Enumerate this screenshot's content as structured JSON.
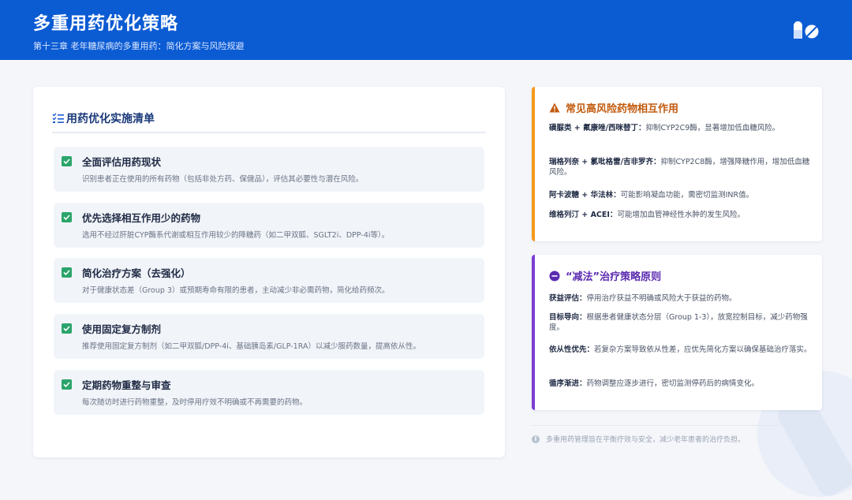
{
  "header": {
    "title": "多重用药优化策略",
    "subtitle": "第十三章 老年糖尿病的多重用药：简化方案与风险规避",
    "logo_icon": "pills-icon"
  },
  "colors": {
    "header_bg": "#0b5bd3",
    "check": "#2ba56b",
    "warning_accent": "#f39a1a",
    "strategy_accent": "#7a3ed1"
  },
  "checklist": {
    "title": "用药优化实施清单",
    "icon": "checklist-icon",
    "items": [
      {
        "title": "全面评估用药现状",
        "desc": "识别患者正在使用的所有药物（包括非处方药、保健品），评估其必要性与潜在风险。"
      },
      {
        "title": "优先选择相互作用少的药物",
        "desc": "选用不经过肝脏CYP酶系代谢或相互作用较少的降糖药（如二甲双胍、SGLT2i、DPP-4i等）。"
      },
      {
        "title": "简化治疗方案（去强化）",
        "desc": "对于健康状态差（Group 3）或预期寿命有限的患者，主动减少非必需药物，简化给药频次。"
      },
      {
        "title": "使用固定复方制剂",
        "desc": "推荐使用固定复方制剂（如二甲双胍/DPP-4i、基础胰岛素/GLP-1RA）以减少服药数量，提高依从性。"
      },
      {
        "title": "定期药物重整与审查",
        "desc": "每次随访时进行药物重整，及时停用疗效不明确或不再需要的药物。"
      }
    ]
  },
  "interactions": {
    "title": "常见高风险药物相互作用",
    "icon": "warning-icon",
    "lines": [
      {
        "bold": "磺脲类 + 氟康唑/西咪替丁：",
        "text": "抑制CYP2C9酶，显著增加低血糖风险。"
      },
      {
        "bold": "瑞格列奈 + 氯吡格雷/吉非罗齐：",
        "text": "抑制CYP2C8酶，增强降糖作用，增加低血糖风险。"
      },
      {
        "bold": "阿卡波糖 + 华法林：",
        "text": "可能影响凝血功能，需密切监测INR值。"
      },
      {
        "bold": "维格列汀 + ACEI：",
        "text": "可能增加血管神经性水肿的发生风险。"
      }
    ]
  },
  "strategy": {
    "title": "“减法”治疗策略原则",
    "icon": "minus-circle-icon",
    "lines": [
      {
        "bold": "获益评估：",
        "text": "停用治疗获益不明确或风险大于获益的药物。"
      },
      {
        "bold": "目标导向：",
        "text": "根据患者健康状态分层（Group 1-3），放宽控制目标，减少药物强度。"
      },
      {
        "bold": "依从性优先：",
        "text": "若复杂方案导致依从性差，应优先简化方案以确保基础治疗落实。"
      },
      {
        "bold": "循序渐进：",
        "text": "药物调整应逐步进行，密切监测停药后的病情变化。"
      }
    ]
  },
  "footnote": {
    "icon": "info-icon",
    "text": "多重用药管理旨在平衡疗效与安全，减少老年患者的治疗负担。"
  }
}
